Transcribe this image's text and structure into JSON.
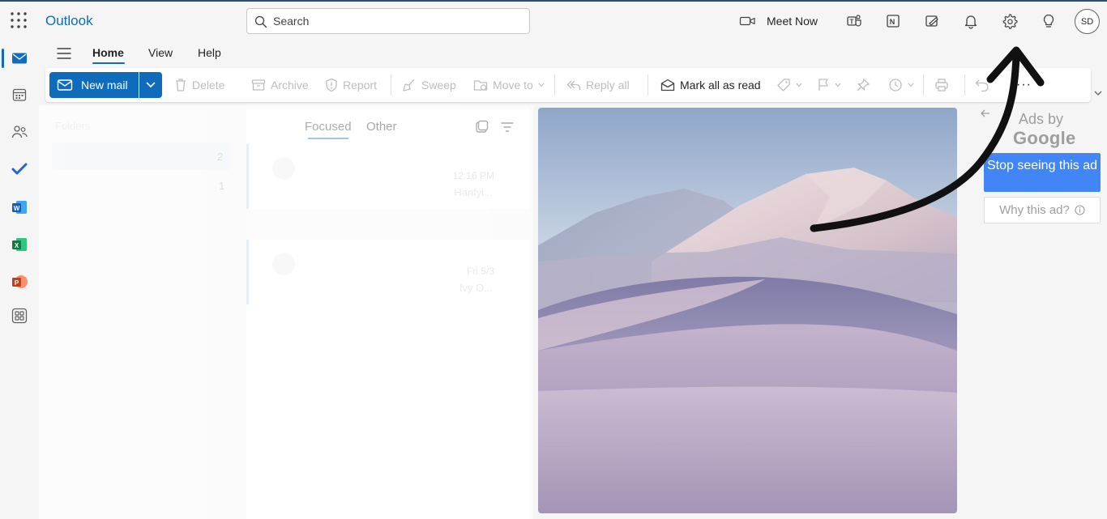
{
  "app": {
    "title": "Outlook"
  },
  "search": {
    "placeholder": "Search"
  },
  "topbar": {
    "meet_now_label": "Meet Now",
    "icons": [
      "teams-icon",
      "onenote-icon",
      "my-day-icon",
      "notifications-icon",
      "settings-icon",
      "tips-icon"
    ],
    "avatar_initials": "SD"
  },
  "rail": {
    "items": [
      "mail-icon",
      "calendar-icon",
      "people-icon",
      "todo-icon",
      "word-icon",
      "excel-icon",
      "powerpoint-icon",
      "more-apps-icon"
    ]
  },
  "tabs": [
    {
      "label": "Home",
      "active": true
    },
    {
      "label": "View",
      "active": false
    },
    {
      "label": "Help",
      "active": false
    }
  ],
  "ribbon": {
    "new_mail": "New mail",
    "delete": "Delete",
    "archive": "Archive",
    "report": "Report",
    "sweep": "Sweep",
    "move_to": "Move to",
    "reply_all": "Reply all",
    "mark_all_read": "Mark all as read",
    "more": "···"
  },
  "folders": {
    "header": "Folders",
    "counts": [
      "2",
      "1"
    ]
  },
  "message_list": {
    "pivots": [
      {
        "label": "Focused",
        "active": true
      },
      {
        "label": "Other",
        "active": false
      }
    ],
    "messages": [
      {
        "time": "12:16 PM",
        "preview": "Hanfyi..."
      },
      {
        "time": "Fri 5/3",
        "preview": "Ivy O..."
      }
    ]
  },
  "ad": {
    "ads_by": "Ads by",
    "google": "Google",
    "stop_label": "Stop seeing this ad",
    "why_label": "Why this ad?"
  },
  "colors": {
    "accent": "#0f6cbd",
    "ad_blue": "#4285f4",
    "annotation": "#111111"
  }
}
